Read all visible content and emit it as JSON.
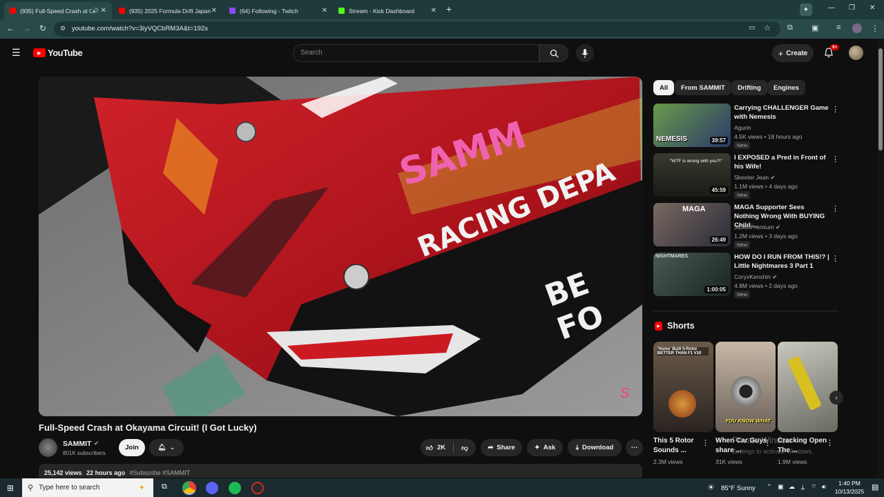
{
  "browser": {
    "tabs": [
      {
        "title": "(935) Full-Speed Crash at O",
        "favicon_color": "#ff0000"
      },
      {
        "title": "(935) 2025 Formula Drift Japan",
        "favicon_color": "#ff0000"
      },
      {
        "title": "(64) Following - Twitch",
        "favicon_color": "#9146ff"
      },
      {
        "title": "Stream - Kick Dashboard",
        "favicon_color": "#53fc18"
      }
    ],
    "url": "youtube.com/watch?v=3iyVQCbRM3A&t=192s"
  },
  "header": {
    "logo_text": "YouTube",
    "search_placeholder": "Search",
    "create_label": "Create",
    "notif_badge": "9+"
  },
  "video": {
    "title": "Full-Speed Crash at Okayama Circuit! (I Got Lucky)",
    "channel": "SAMMIT",
    "subscribers": "801K subscribers",
    "join_label": "Join",
    "likes": "2K",
    "share_label": "Share",
    "ask_label": "Ask",
    "download_label": "Download",
    "views": "25,142 views",
    "age": "22 hours ago",
    "tags": "#Subscribe #SAMMIT",
    "overlay_lines": [
      "SAMM",
      "RACING DEPA",
      "BE FO"
    ]
  },
  "chips": [
    "All",
    "From SAMMIT",
    "Drifting",
    "Engines"
  ],
  "recommendations": [
    {
      "title": "Carrying CHALLENGER Game with Nemesis",
      "channel": "Agurin",
      "meta": "4.5K views • 18 hours ago",
      "badge": "New",
      "duration": "39:57",
      "thumb_text": "NEMESIS",
      "thumb_color": "#4a7a3a"
    },
    {
      "title": "I EXPOSED a Pred in Front of his Wife!",
      "channel": "Skeeter Jean",
      "meta": "1.1M views • 4 days ago",
      "badge": "New",
      "duration": "45:59",
      "thumb_text": "\"WTF is wrong with you?!\"",
      "thumb_color": "#2a2a22"
    },
    {
      "title": "MAGA Supporter Sees Nothing Wrong With BUYING Child ...",
      "channel": "JiDionPremium",
      "meta": "1.2M views • 3 days ago",
      "badge": "New",
      "duration": "26:49",
      "thumb_text": "MAGA",
      "thumb_color": "#5a4a40"
    },
    {
      "title": "HOW DO I RUN FROM THIS!? | Little Nightmares 3 Part 1",
      "channel": "CoryxKenshin",
      "meta": "4.8M views • 2 days ago",
      "badge": "New",
      "duration": "1:00:05",
      "thumb_text": "NIGHTMARES",
      "thumb_color": "#3c4a46"
    }
  ],
  "shorts_heading": "Shorts",
  "shorts": [
    {
      "title": "This 5 Rotor Sounds ...",
      "views": "2.3M views",
      "thumb_text": "'Home' Built 5-Rotor BETTER THAN F1 V10",
      "thumb_color": "#5a4a3a"
    },
    {
      "title": "When Car Guys share ...",
      "views": "31K views",
      "thumb_text": "YOU KNOW WHAT",
      "thumb_color": "#9a8a7a"
    },
    {
      "title": "Cracking Open The ...",
      "views": "1.9M views",
      "thumb_text": "",
      "thumb_color": "#8a8a7a"
    }
  ],
  "watermark": {
    "line1": "Private Window",
    "line2": "Settings to activate Windows."
  },
  "taskbar": {
    "search_placeholder": "Type here to search",
    "weather": "85°F  Sunny",
    "time": "1:40 PM",
    "date": "10/13/2025"
  },
  "colors": {
    "bg": "#0f0f0f",
    "surface": "#272727",
    "muted_text": "#aaaaaa",
    "yt_red": "#ff0000",
    "car_red": "#c0141c"
  }
}
